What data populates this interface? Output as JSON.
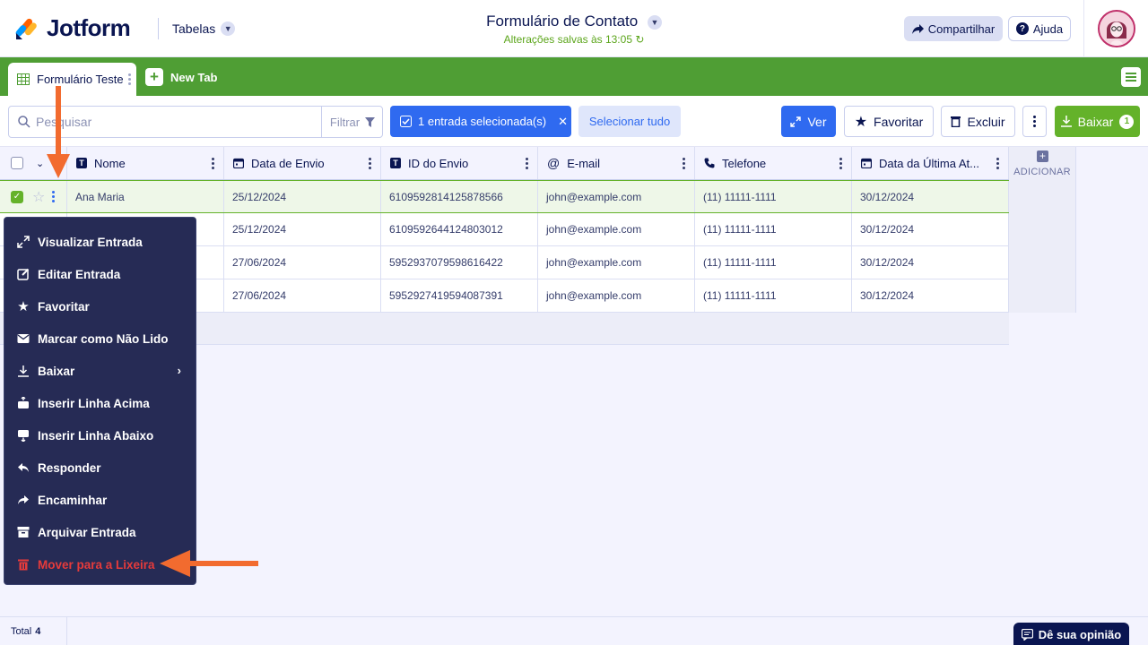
{
  "header": {
    "brand": "Jotform",
    "section": "Tabelas",
    "form_title": "Formulário de Contato",
    "saved_status": "Alterações salvas às 13:05",
    "share_label": "Compartilhar",
    "help_label": "Ajuda"
  },
  "tabs": {
    "active_label": "Formulário Teste",
    "new_tab_label": "New Tab"
  },
  "toolbar": {
    "search_placeholder": "Pesquisar",
    "filter_label": "Filtrar",
    "selected_label": "1 entrada selecionada(s)",
    "select_all_label": "Selecionar tudo",
    "view_label": "Ver",
    "favorite_label": "Favoritar",
    "delete_label": "Excluir",
    "download_label": "Baixar",
    "download_count": "1"
  },
  "table": {
    "columns": [
      {
        "label": "Nome",
        "icon": "text-type-icon"
      },
      {
        "label": "Data de Envio",
        "icon": "calendar-icon"
      },
      {
        "label": "ID do Envio",
        "icon": "text-type-icon"
      },
      {
        "label": "E-mail",
        "icon": "at-icon"
      },
      {
        "label": "Telefone",
        "icon": "phone-icon"
      },
      {
        "label": "Data da Última At...",
        "icon": "calendar-icon"
      }
    ],
    "add_column_label": "ADICIONAR",
    "rows": [
      {
        "nome": "Ana Maria",
        "data_envio": "25/12/2024",
        "id_envio": "6109592814125878566",
        "email": "john@example.com",
        "telefone": "(11) 11111-1111",
        "ultima_atualizacao": "30/12/2024",
        "selected": true
      },
      {
        "nome": "",
        "data_envio": "25/12/2024",
        "id_envio": "6109592644124803012",
        "email": "john@example.com",
        "telefone": "(11) 11111-1111",
        "ultima_atualizacao": "30/12/2024",
        "selected": false
      },
      {
        "nome": "",
        "data_envio": "27/06/2024",
        "id_envio": "5952937079598616422",
        "email": "john@example.com",
        "telefone": "(11) 11111-1111",
        "ultima_atualizacao": "30/12/2024",
        "selected": false
      },
      {
        "nome": "",
        "data_envio": "27/06/2024",
        "id_envio": "5952927419594087391",
        "email": "john@example.com",
        "telefone": "(11) 11111-1111",
        "ultima_atualizacao": "30/12/2024",
        "selected": false
      }
    ]
  },
  "context_menu": {
    "items": [
      {
        "label": "Visualizar Entrada",
        "icon": "expand-icon"
      },
      {
        "label": "Editar Entrada",
        "icon": "edit-icon"
      },
      {
        "label": "Favoritar",
        "icon": "star-icon"
      },
      {
        "label": "Marcar como Não Lido",
        "icon": "envelope-icon"
      },
      {
        "label": "Baixar",
        "icon": "download-icon",
        "submenu": true
      },
      {
        "label": "Inserir Linha Acima",
        "icon": "insert-above-icon"
      },
      {
        "label": "Inserir Linha Abaixo",
        "icon": "insert-below-icon"
      },
      {
        "label": "Responder",
        "icon": "reply-icon"
      },
      {
        "label": "Encaminhar",
        "icon": "forward-icon"
      },
      {
        "label": "Arquivar Entrada",
        "icon": "archive-icon"
      },
      {
        "label": "Mover para a Lixeira",
        "icon": "trash-icon",
        "danger": true
      }
    ]
  },
  "footer": {
    "total_label": "Total",
    "total_count": "4",
    "feedback_label": "Dê sua opinião"
  },
  "colors": {
    "brand_green": "#4f9e34",
    "accent_blue": "#2f6af0",
    "menu_bg": "#262b55",
    "danger": "#e53b3b",
    "annotation_arrow": "#f26b2f"
  }
}
